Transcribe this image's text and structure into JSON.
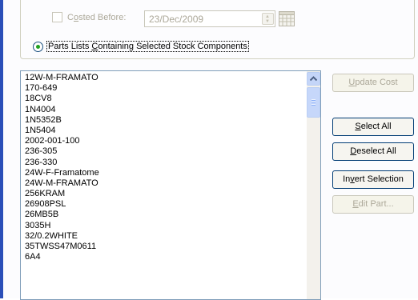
{
  "filter": {
    "costed_before_label_pre": "C",
    "costed_before_label_key": "o",
    "costed_before_label_post": "sted Before:",
    "costed_before_checked": false,
    "date_value": "23/Dec/2009",
    "parts_option_pre": "Parts Lists ",
    "parts_option_key": "C",
    "parts_option_post": "ontaining Selected Stock Components",
    "parts_option_selected": true
  },
  "parts_list": {
    "items": [
      "12W-M-FRAMATO",
      "170-649",
      "18CV8",
      "1N4004",
      "1N5352B",
      "1N5404",
      "2002-001-100",
      "236-305",
      "236-330",
      "24W-F-Framatome",
      "24W-M-FRAMATO",
      "256KRAM",
      "26908PSL",
      "26MB5B",
      "3035H",
      "32/0.2WHITE",
      "35TWSS47M0611",
      "6A4"
    ]
  },
  "buttons": {
    "update_cost": {
      "pre": "",
      "key": "U",
      "post": "pdate Cost",
      "enabled": false
    },
    "select_all": {
      "pre": "",
      "key": "S",
      "post": "elect All",
      "enabled": true
    },
    "deselect_all": {
      "pre": "",
      "key": "D",
      "post": "eselect All",
      "enabled": true
    },
    "invert_selection": {
      "pre": "In",
      "key": "v",
      "post": "ert Selection",
      "enabled": true
    },
    "edit_part": {
      "pre": "",
      "key": "E",
      "post": "dit Part...",
      "enabled": false
    }
  },
  "colors": {
    "accent": "#2B4FB8",
    "radio_dot": "#21A121",
    "disabled_text": "#ACA899",
    "button_border": "#003C74"
  }
}
